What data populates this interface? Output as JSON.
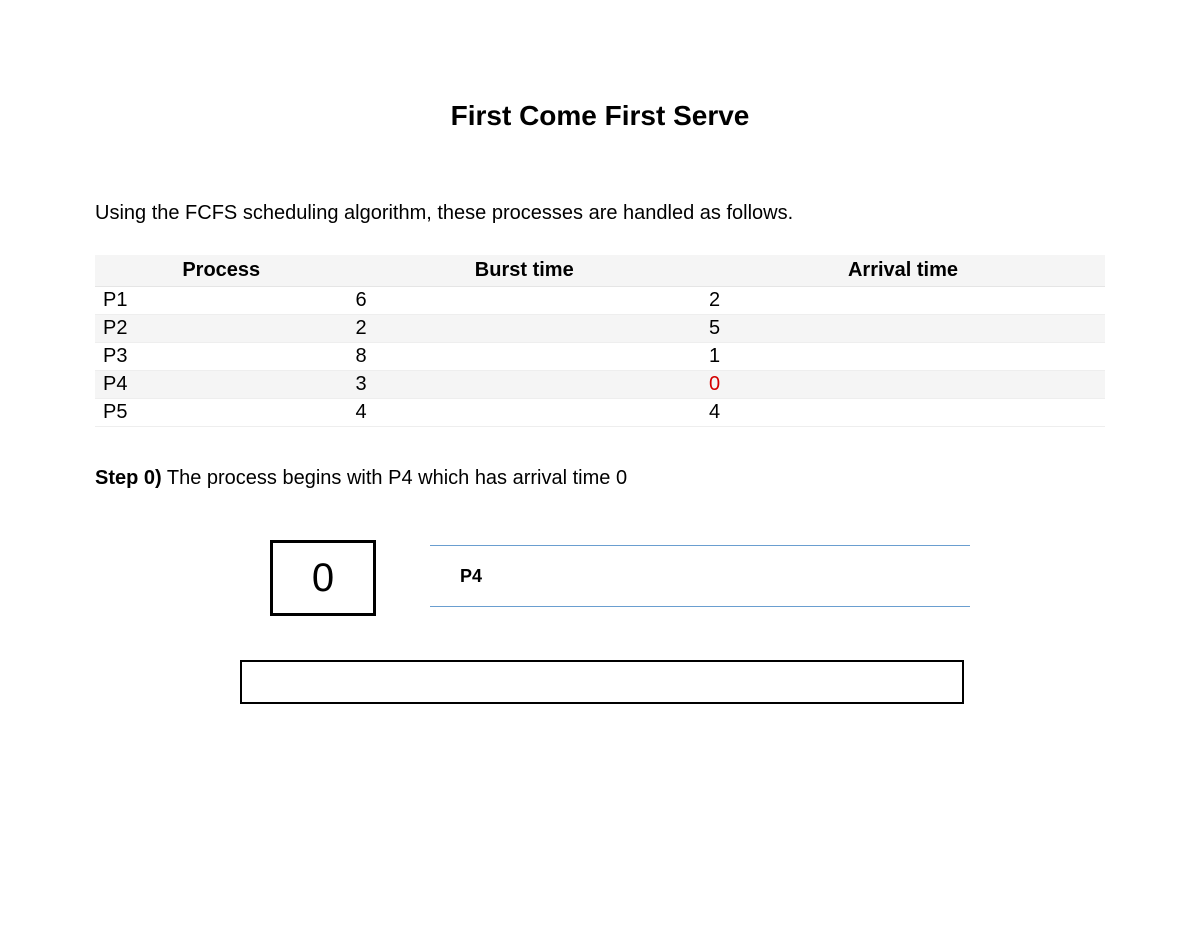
{
  "title": "First Come First Serve",
  "intro": "Using the FCFS scheduling algorithm, these processes are handled as follows.",
  "table": {
    "headers": [
      "Process",
      "Burst time",
      "Arrival time"
    ],
    "rows": [
      {
        "process": "P1",
        "burst": "6",
        "arrival": "2",
        "highlight": false
      },
      {
        "process": "P2",
        "burst": "2",
        "arrival": "5",
        "highlight": false
      },
      {
        "process": "P3",
        "burst": "8",
        "arrival": "1",
        "highlight": false
      },
      {
        "process": "P4",
        "burst": "3",
        "arrival": "0",
        "highlight": true
      },
      {
        "process": "P5",
        "burst": "4",
        "arrival": "4",
        "highlight": false
      }
    ]
  },
  "step": {
    "label": "Step 0)",
    "text": " The process begins with P4 which has arrival time 0"
  },
  "diagram": {
    "time": "0",
    "queue_item": "P4"
  }
}
